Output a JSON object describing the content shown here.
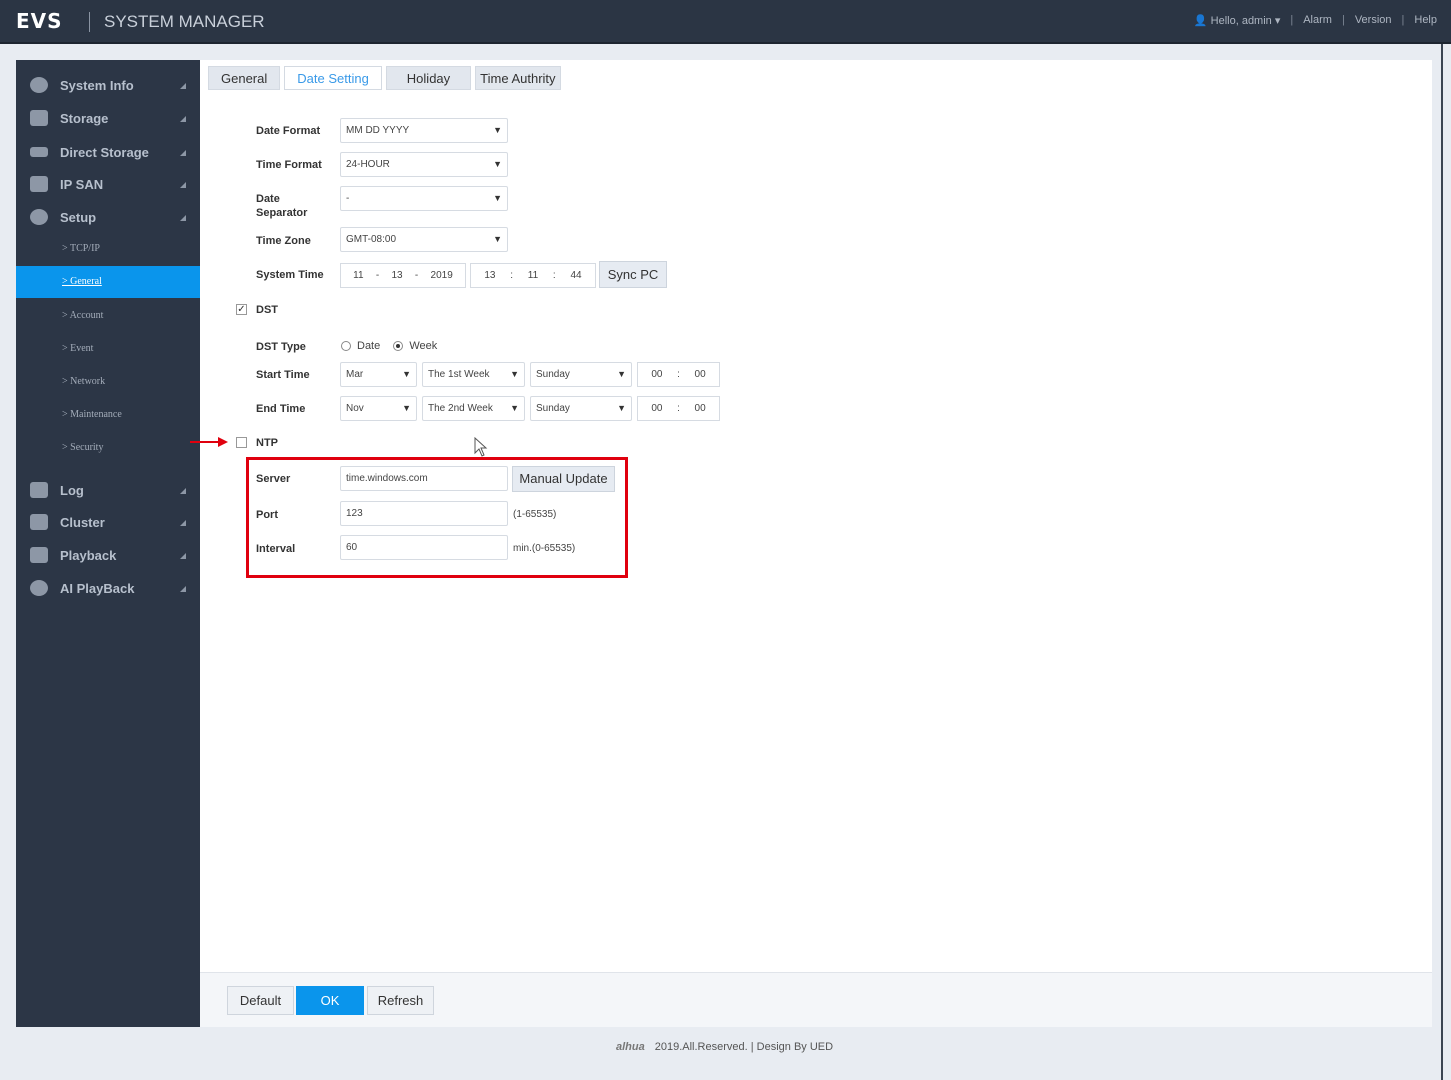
{
  "header": {
    "logo": "EVS",
    "title": "SYSTEM MANAGER",
    "user": "Hello, admin",
    "alarm": "Alarm",
    "version": "Version",
    "help": "Help"
  },
  "sidebar": {
    "items": [
      {
        "label": "System Info",
        "icon": "pie-chart-icon"
      },
      {
        "label": "Storage",
        "icon": "disk-icon"
      },
      {
        "label": "Direct Storage",
        "icon": "direct-storage-icon"
      },
      {
        "label": "IP SAN",
        "icon": "san-icon"
      },
      {
        "label": "Setup",
        "icon": "gear-icon"
      },
      {
        "label": "Log",
        "icon": "document-icon"
      },
      {
        "label": "Cluster",
        "icon": "cluster-icon"
      },
      {
        "label": "Playback",
        "icon": "playback-icon"
      },
      {
        "label": "AI PlayBack",
        "icon": "ai-playback-icon"
      }
    ],
    "sub": [
      "> TCP/IP",
      "> General",
      "> Account",
      "> Event",
      "> Network",
      "> Maintenance",
      "> Security"
    ]
  },
  "tabs": [
    "General",
    "Date Setting",
    "Holiday",
    "Time Authrity"
  ],
  "form": {
    "date_format": {
      "label": "Date Format",
      "value": "MM DD YYYY"
    },
    "time_format": {
      "label": "Time Format",
      "value": "24-HOUR"
    },
    "date_sep": {
      "label1": "Date",
      "label2": "Separator",
      "value": "-"
    },
    "time_zone": {
      "label": "Time Zone",
      "value": "GMT-08:00"
    },
    "system_time": {
      "label": "System Time",
      "month": "11",
      "day": "13",
      "year": "2019",
      "hour": "13",
      "min": "11",
      "sec": "44",
      "dash": "-",
      "colon": ":",
      "sync": "Sync PC"
    },
    "dst": {
      "label": "DST",
      "checked": true
    },
    "dst_type": {
      "label": "DST Type",
      "date": "Date",
      "week": "Week",
      "selected": "Week"
    },
    "start": {
      "label": "Start Time",
      "month": "Mar",
      "week": "The 1st Week",
      "day": "Sunday",
      "h": "00",
      "m": "00"
    },
    "end": {
      "label": "End Time",
      "month": "Nov",
      "week": "The 2nd Week",
      "day": "Sunday",
      "h": "00",
      "m": "00"
    },
    "ntp": {
      "label": "NTP",
      "checked": false
    },
    "server": {
      "label": "Server",
      "value": "time.windows.com",
      "btn": "Manual Update"
    },
    "port": {
      "label": "Port",
      "value": "123",
      "hint": "(1-65535)"
    },
    "interval": {
      "label": "Interval",
      "value": "60",
      "hint": "min.(0-65535)"
    }
  },
  "buttons": {
    "default": "Default",
    "ok": "OK",
    "refresh": "Refresh"
  },
  "footer": {
    "brand": "alhua",
    "text": "2019.All.Reserved. | Design By UED"
  },
  "colors": {
    "accent": "#0a95ec",
    "highlight": "#e0000e"
  }
}
